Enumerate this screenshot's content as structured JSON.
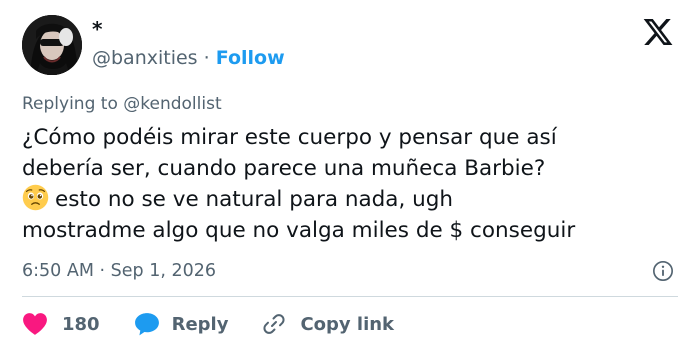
{
  "author": {
    "display_name": "*",
    "handle": "@banxities",
    "separator": "·",
    "follow_label": "Follow"
  },
  "reply_context": {
    "prefix": "Replying to",
    "mention": "@kendollist"
  },
  "tweet": {
    "lines": [
      "¿Cómo podéis mirar este cuerpo y pensar que así",
      "debería ser, cuando parece una muñeca Barbie?",
      "esto no se ve natural para nada, ugh",
      "mostradme algo que no valga miles de $ conseguir"
    ],
    "emoji": "pleading-face"
  },
  "meta": {
    "time": "6:50 AM",
    "separator": "·",
    "date": "Sep 1, 2026"
  },
  "actions": {
    "like_count": "180",
    "reply_label": "Reply",
    "copy_label": "Copy link"
  },
  "colors": {
    "link": "#1d9bf0",
    "like": "#f91880",
    "secondary_text": "#536471",
    "primary_text": "#0f1419",
    "divider": "#cfd9de"
  },
  "icons": {
    "brand": "x-logo-icon",
    "info": "info-icon",
    "like": "heart-icon",
    "reply": "speech-bubble-icon",
    "copy": "link-icon"
  }
}
